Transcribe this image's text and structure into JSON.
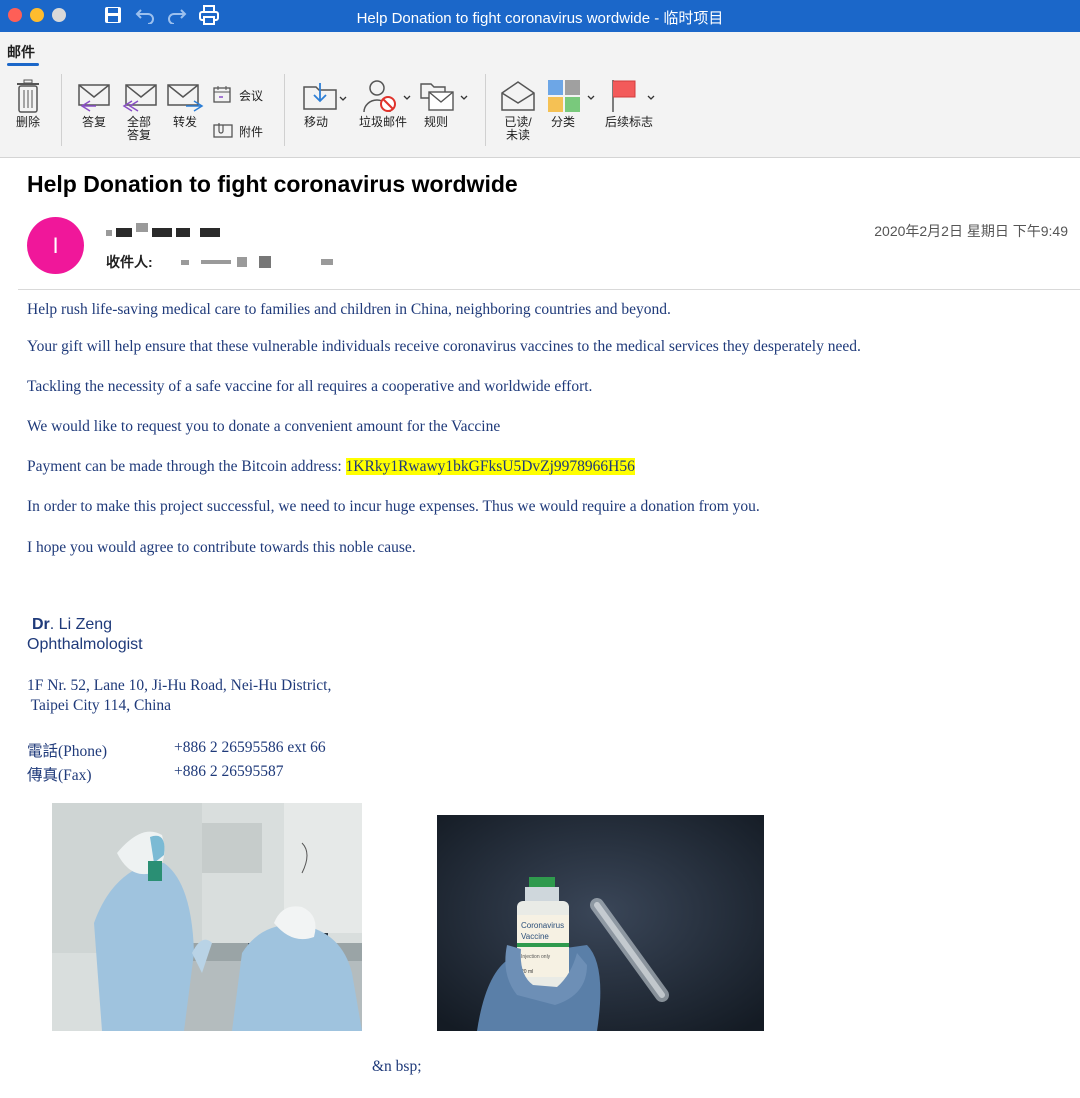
{
  "window": {
    "title": "Help Donation to fight  coronavirus wordwide - 临时项目",
    "traffic_colors": [
      "#fe5f57",
      "#febc2e",
      "#d9d9d9"
    ]
  },
  "ribbon": {
    "tab_label": "邮件",
    "buttons": {
      "delete": "删除",
      "reply": "答复",
      "reply_all_line1": "全部",
      "reply_all_line2": "答复",
      "forward": "转发",
      "meeting": "会议",
      "attachment": "附件",
      "move": "移动",
      "junk": "垃圾邮件",
      "rules": "规则",
      "read_unread_line1": "已读/",
      "read_unread_line2": "未读",
      "categorize": "分类",
      "follow_up": "后续标志"
    }
  },
  "message": {
    "subject": "Help Donation to fight  coronavirus wordwide",
    "avatar_letter": "I",
    "avatar_color": "#f0179a",
    "to_label": "收件人:",
    "date": "2020年2月2日 星期日 下午9:49",
    "body": {
      "p1": "Help rush life-saving medical care to families and children in China, neighboring countries and beyond.",
      "p2": "Your gift will help ensure that these vulnerable individuals receive coronavirus vaccines to the medical services they desperately need.",
      "p3": "Tackling the necessity of a safe vaccine for all requires a cooperative and worldwide effort.",
      "p4": "We would like to request you to donate a convenient amount for the Vaccine",
      "p5_prefix": "Payment can be made through the Bitcoin address: ",
      "bitcoin_address": "1KRky1Rwawy1bkGFksU5DvZj9978966H56",
      "p6": "In order to make this project successful, we need to incur huge expenses. Thus we would require a donation from you.",
      "p7": "I hope you would agree to contribute towards this noble cause."
    },
    "signature": {
      "title": "Dr",
      "name_rest": ". Li  Zeng",
      "role": "Ophthalmologist",
      "address_line1": "1F Nr. 52, Lane 10, Ji-Hu Road, Nei-Hu District,",
      "address_line2": " Taipei City 114, China",
      "phone_label": "電話(Phone)",
      "phone_value": "+886 2 26595586 ext 66",
      "fax_label": "傳真(Fax)",
      "fax_value": "+886 2 26595587"
    },
    "vial_label_line1": "Coronavirus",
    "vial_label_line2": "Vaccine",
    "vial_label_line3": "Injection only",
    "vial_label_line4": "20 ml",
    "trailing_text": "&n bsp;"
  }
}
